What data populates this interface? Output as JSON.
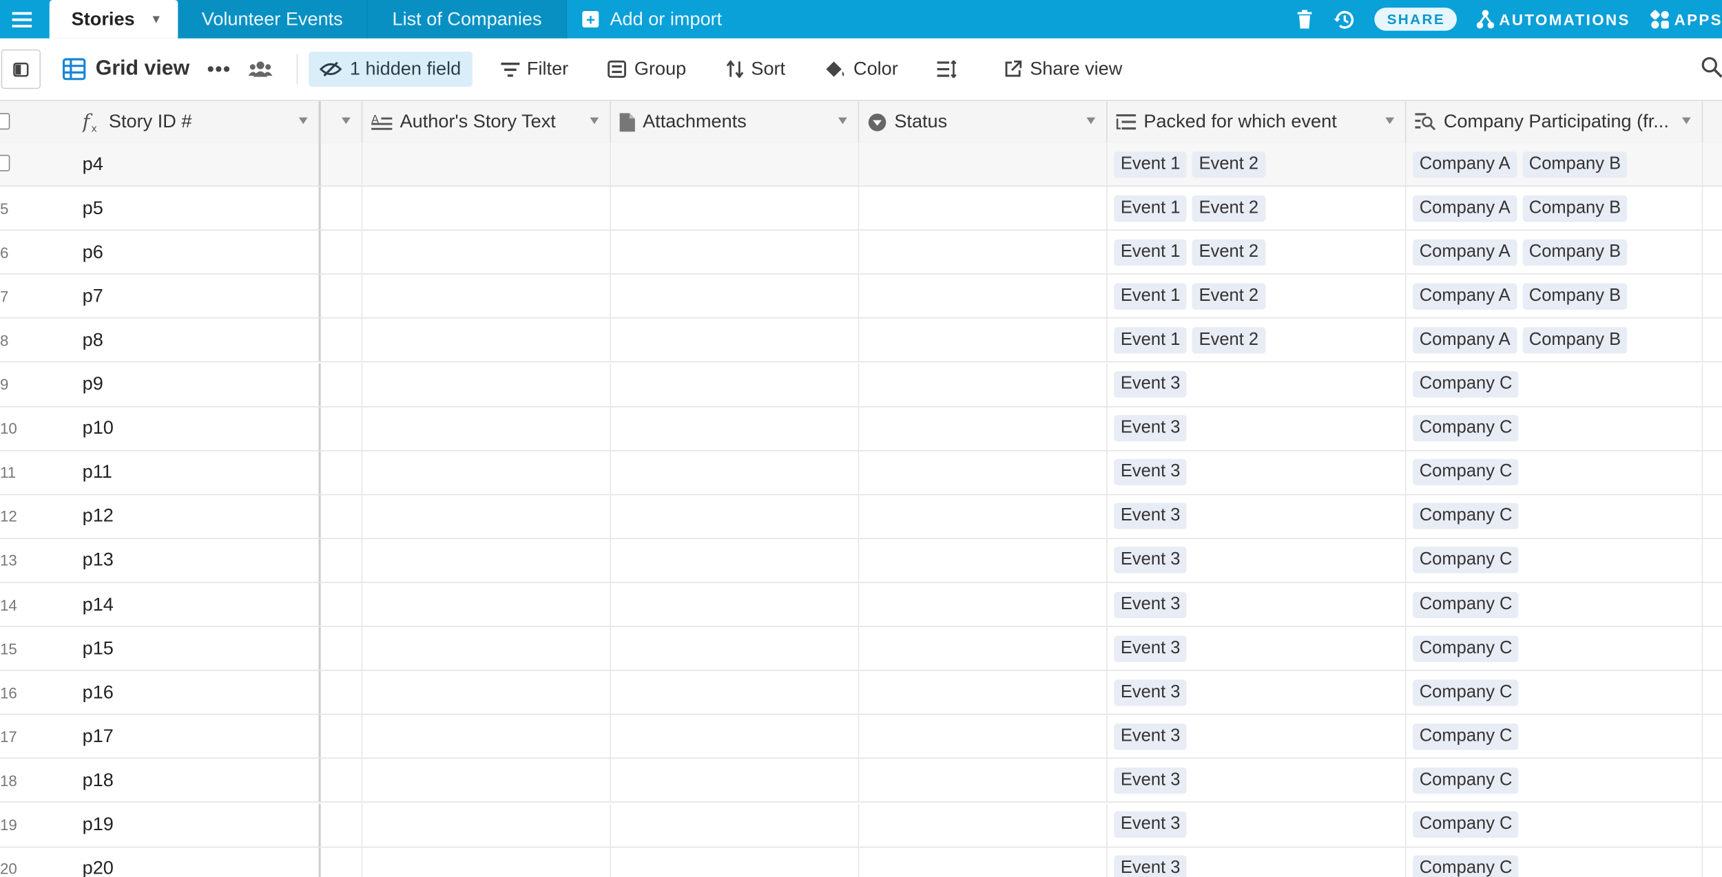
{
  "topbar": {
    "tabs": [
      {
        "label": "Stories",
        "active": true
      },
      {
        "label": "Volunteer Events",
        "active": false
      },
      {
        "label": "List of Companies",
        "active": false
      }
    ],
    "add_import": "Add or import",
    "share_label": "SHARE",
    "automations_label": "AUTOMATIONS",
    "apps_label": "APPS",
    "accent_color": "#0aa0d8"
  },
  "toolbar": {
    "view_name": "Grid view",
    "more_label": "•••",
    "hidden_fields": "1 hidden field",
    "filter": "Filter",
    "group": "Group",
    "sort": "Sort",
    "color": "Color",
    "share_view": "Share view"
  },
  "columns": {
    "story_id": "Story ID #",
    "author_text": "Author's Story Text",
    "attachments": "Attachments",
    "status": "Status",
    "packed_event": "Packed for which event",
    "company": "Company Participating (fr..."
  },
  "rows": [
    {
      "num": "",
      "id": "p4",
      "events": [
        "Event 1",
        "Event 2"
      ],
      "companies": [
        "Company A",
        "Company B"
      ]
    },
    {
      "num": "5",
      "id": "p5",
      "events": [
        "Event 1",
        "Event 2"
      ],
      "companies": [
        "Company A",
        "Company B"
      ]
    },
    {
      "num": "6",
      "id": "p6",
      "events": [
        "Event 1",
        "Event 2"
      ],
      "companies": [
        "Company A",
        "Company B"
      ]
    },
    {
      "num": "7",
      "id": "p7",
      "events": [
        "Event 1",
        "Event 2"
      ],
      "companies": [
        "Company A",
        "Company B"
      ]
    },
    {
      "num": "8",
      "id": "p8",
      "events": [
        "Event 1",
        "Event 2"
      ],
      "companies": [
        "Company A",
        "Company B"
      ]
    },
    {
      "num": "9",
      "id": "p9",
      "events": [
        "Event 3"
      ],
      "companies": [
        "Company C"
      ]
    },
    {
      "num": "10",
      "id": "p10",
      "events": [
        "Event 3"
      ],
      "companies": [
        "Company C"
      ]
    },
    {
      "num": "11",
      "id": "p11",
      "events": [
        "Event 3"
      ],
      "companies": [
        "Company C"
      ]
    },
    {
      "num": "12",
      "id": "p12",
      "events": [
        "Event 3"
      ],
      "companies": [
        "Company C"
      ]
    },
    {
      "num": "13",
      "id": "p13",
      "events": [
        "Event 3"
      ],
      "companies": [
        "Company C"
      ]
    },
    {
      "num": "14",
      "id": "p14",
      "events": [
        "Event 3"
      ],
      "companies": [
        "Company C"
      ]
    },
    {
      "num": "15",
      "id": "p15",
      "events": [
        "Event 3"
      ],
      "companies": [
        "Company C"
      ]
    },
    {
      "num": "16",
      "id": "p16",
      "events": [
        "Event 3"
      ],
      "companies": [
        "Company C"
      ]
    },
    {
      "num": "17",
      "id": "p17",
      "events": [
        "Event 3"
      ],
      "companies": [
        "Company C"
      ]
    },
    {
      "num": "18",
      "id": "p18",
      "events": [
        "Event 3"
      ],
      "companies": [
        "Company C"
      ]
    },
    {
      "num": "19",
      "id": "p19",
      "events": [
        "Event 3"
      ],
      "companies": [
        "Company C"
      ]
    },
    {
      "num": "20",
      "id": "p20",
      "events": [
        "Event 3"
      ],
      "companies": [
        "Company C"
      ]
    }
  ]
}
